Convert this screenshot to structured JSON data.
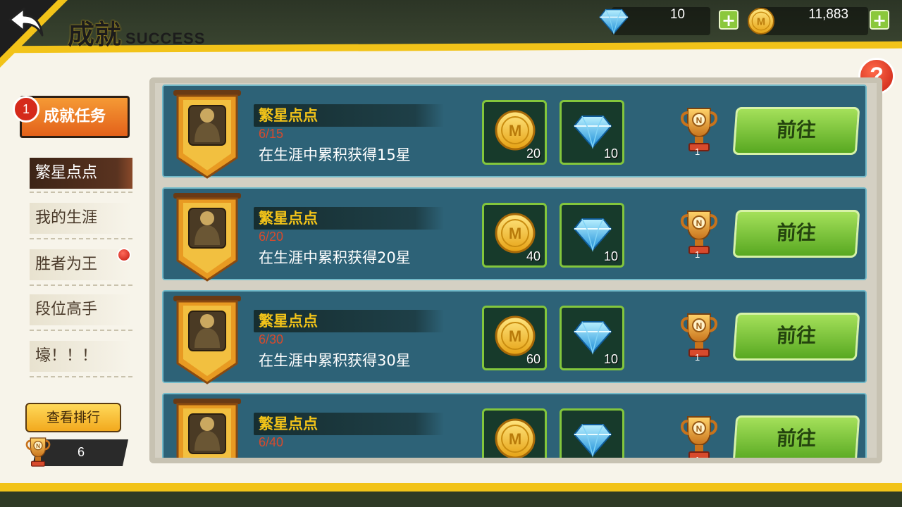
{
  "header": {
    "title": "成就",
    "subtitle": "SUCCESS",
    "back_icon": "back-arrow-icon",
    "diamonds": "10",
    "coins": "11,883",
    "add_label": "+"
  },
  "help": {
    "label": "?"
  },
  "sidebar": {
    "tab": {
      "label": "成就任务",
      "badge": "1"
    },
    "items": [
      {
        "label": "繁星点点"
      },
      {
        "label": "我的生涯"
      },
      {
        "label": "胜者为王"
      },
      {
        "label": "段位高手"
      },
      {
        "label": "壕！！！"
      }
    ],
    "rank_button": "查看排行",
    "rank_value": "6"
  },
  "achievements": [
    {
      "name": "繁星点点",
      "progress": "6/15",
      "desc": "在生涯中累积获得15星",
      "coin_reward": "20",
      "gem_reward": "10",
      "trophy": "1",
      "button": "前往"
    },
    {
      "name": "繁星点点",
      "progress": "6/20",
      "desc": "在生涯中累积获得20星",
      "coin_reward": "40",
      "gem_reward": "10",
      "trophy": "1",
      "button": "前往"
    },
    {
      "name": "繁星点点",
      "progress": "6/30",
      "desc": "在生涯中累积获得30星",
      "coin_reward": "60",
      "gem_reward": "10",
      "trophy": "1",
      "button": "前往"
    },
    {
      "name": "繁星点点",
      "progress": "6/40",
      "desc": "",
      "coin_reward": "",
      "gem_reward": "",
      "trophy": "1",
      "button": "前往"
    }
  ],
  "colors": {
    "accent": "#f2c319",
    "card": "#2d6277",
    "button_green": "#8bc83c",
    "tab_orange": "#e3611a",
    "alert_red": "#d52a1b"
  }
}
